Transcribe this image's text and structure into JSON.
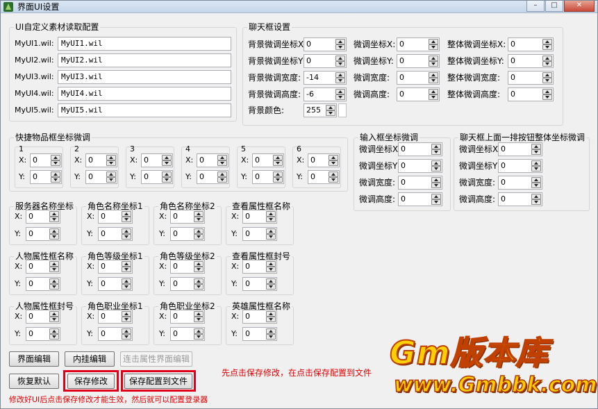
{
  "window": {
    "title": "界面UI设置"
  },
  "ui_group": {
    "legend": "UI自定义素材读取配置",
    "rows": [
      {
        "label": "MyUI1.wil:",
        "value": "MyUI1.wil"
      },
      {
        "label": "MyUI2.wil:",
        "value": "MyUI2.wil"
      },
      {
        "label": "MyUI3.wil:",
        "value": "MyUI3.wil"
      },
      {
        "label": "MyUI4.wil:",
        "value": "MyUI4.wil"
      },
      {
        "label": "MyUI5.wil:",
        "value": "MyUI5.wil"
      }
    ]
  },
  "chat_group": {
    "legend": "聊天框设置",
    "col1": [
      {
        "label": "背景微调坐标X",
        "value": "0"
      },
      {
        "label": "背景微调坐标Y",
        "value": "0"
      },
      {
        "label": "背景微调宽度:",
        "value": "-14"
      },
      {
        "label": "背景微调高度:",
        "value": "-6"
      }
    ],
    "col2": [
      {
        "label": "微调坐标X:",
        "value": "0"
      },
      {
        "label": "微调坐标Y:",
        "value": "0"
      },
      {
        "label": "微调宽度:",
        "value": "0"
      },
      {
        "label": "微调高度:",
        "value": "0"
      }
    ],
    "col3": [
      {
        "label": "整体微调坐标X:",
        "value": "0"
      },
      {
        "label": "整体微调坐标Y:",
        "value": "0"
      },
      {
        "label": "整体微调宽度:",
        "value": "0"
      },
      {
        "label": "整体微调高度:",
        "value": "0"
      }
    ],
    "bg_color_label": "背景颜色:",
    "bg_color_value": "255"
  },
  "quick_group": {
    "legend": "快捷物品框坐标微调",
    "slots": [
      {
        "num": "1",
        "x": "0",
        "y": "0"
      },
      {
        "num": "2",
        "x": "0",
        "y": "0"
      },
      {
        "num": "3",
        "x": "0",
        "y": "0"
      },
      {
        "num": "4",
        "x": "0",
        "y": "0"
      },
      {
        "num": "5",
        "x": "0",
        "y": "0"
      },
      {
        "num": "6",
        "x": "0",
        "y": "0"
      }
    ],
    "x_label": "X:",
    "y_label": "Y:"
  },
  "input_group": {
    "legend": "输入框坐标微调",
    "rows": [
      {
        "label": "微调坐标X",
        "value": "0"
      },
      {
        "label": "微调坐标Y",
        "value": "0"
      },
      {
        "label": "微调宽度:",
        "value": "0"
      },
      {
        "label": "微调高度:",
        "value": "0"
      }
    ]
  },
  "chatbtn_group": {
    "legend": "聊天框上面一排按钮整体坐标微调",
    "rows": [
      {
        "label": "微调坐标X",
        "value": "0"
      },
      {
        "label": "微调坐标Y",
        "value": "0"
      },
      {
        "label": "微调宽度:",
        "value": "0"
      },
      {
        "label": "微调高度:",
        "value": "0"
      }
    ]
  },
  "coord_groups": [
    {
      "legend": "服务器名称坐标",
      "x": "0",
      "y": "0"
    },
    {
      "legend": "角色名称坐标1",
      "x": "0",
      "y": "0"
    },
    {
      "legend": "角色名称坐标2",
      "x": "0",
      "y": "0"
    },
    {
      "legend": "查看属性框名称",
      "x": "0",
      "y": "0"
    },
    {
      "legend": "人物属性框名称",
      "x": "0",
      "y": "0"
    },
    {
      "legend": "角色等级坐标1",
      "x": "0",
      "y": "0"
    },
    {
      "legend": "角色等级坐标2",
      "x": "0",
      "y": "0"
    },
    {
      "legend": "查看属性框封号",
      "x": "0",
      "y": "0"
    },
    {
      "legend": "人物属性框封号",
      "x": "0",
      "y": "0"
    },
    {
      "legend": "角色职业坐标1",
      "x": "0",
      "y": "0"
    },
    {
      "legend": "角色职业坐标2",
      "x": "0",
      "y": "0"
    },
    {
      "legend": "英雄属性框名称",
      "x": "0",
      "y": "0"
    }
  ],
  "buttons": {
    "ui_edit": "界面编辑",
    "plugin_edit": "内挂编辑",
    "attr_edit": "连击属性界面编辑",
    "restore_default": "恢复默认",
    "save_changes": "保存修改",
    "save_config": "保存配置到文件"
  },
  "annotation": "先点击保存修改，在点击保存配置到文件",
  "status": "修改好UI后点击保存修改才能生效，然后就可以配置登录器",
  "watermark": {
    "line1": "Gm版本库",
    "line2": "www.Gmbbk.com"
  },
  "colors": {
    "accent_red": "#e00000",
    "watermark_yellow": "#ffd000"
  }
}
